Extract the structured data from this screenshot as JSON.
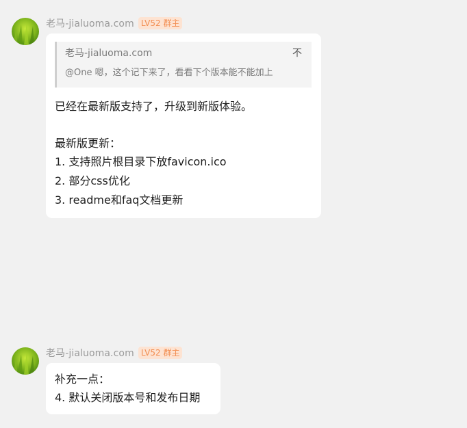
{
  "messages": [
    {
      "sender": "老马-jialuoma.com",
      "badge": "LV52 群主",
      "quote": {
        "name": "老马-jialuoma.com",
        "fold_glyph": "不",
        "text": "@One 嗯，这个记下来了，看看下个版本能不能加上"
      },
      "lines": [
        "已经在最新版支持了，升级到新版体验。",
        "",
        "最新版更新：",
        "1. 支持照片根目录下放favicon.ico",
        "2. 部分css优化",
        "3. readme和faq文档更新"
      ]
    },
    {
      "sender": "老马-jialuoma.com",
      "badge": "LV52 群主",
      "lines": [
        "补充一点：",
        "4. 默认关闭版本号和发布日期"
      ]
    }
  ],
  "colors": {
    "background": "#f1f1f1",
    "bubble": "#ffffff",
    "badge_text": "#f28e52",
    "badge_bg": "#fde3d2"
  },
  "icons": {
    "avatar": "green-grass-avatar",
    "fold": "fold-icon"
  }
}
